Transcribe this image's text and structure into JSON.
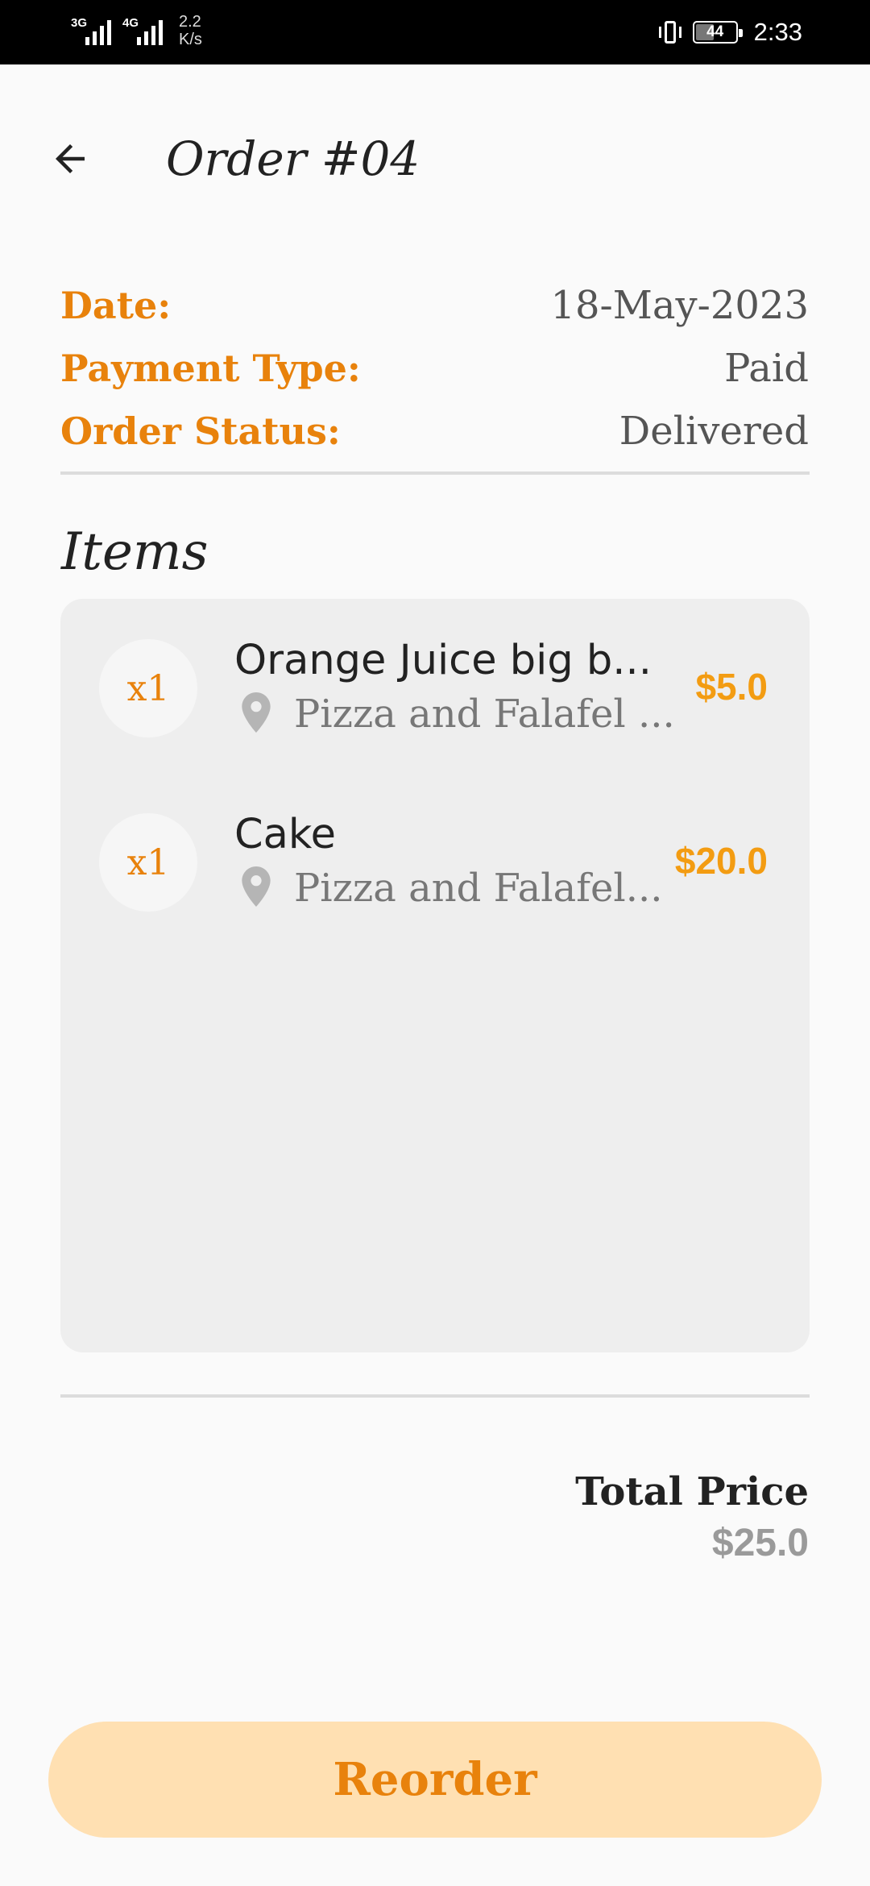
{
  "status_bar": {
    "network1": "3G",
    "network2": "4G",
    "net_speed_value": "2.2",
    "net_speed_unit": "K/s",
    "battery": "44",
    "time": "2:33"
  },
  "header": {
    "back_icon": "arrow-left-icon",
    "title": "Order #04"
  },
  "order_info": {
    "date_label": "Date:",
    "date_value": "18-May-2023",
    "payment_label": "Payment Type:",
    "payment_value": "Paid",
    "status_label": "Order Status:",
    "status_value": "Delivered"
  },
  "items_section": {
    "heading": "Items",
    "items": [
      {
        "qty": "x1",
        "name": "Orange Juice big b...",
        "store": "Pizza and Falafel ...",
        "price": "$5.0"
      },
      {
        "qty": "x1",
        "name": "Cake",
        "store": "Pizza and Falafel...",
        "price": "$20.0"
      }
    ]
  },
  "total": {
    "label": "Total Price",
    "value": "$25.0"
  },
  "actions": {
    "reorder_label": "Reorder"
  },
  "colors": {
    "accent": "#e8820c",
    "price": "#f39c12",
    "button_bg": "#ffe0b2",
    "card_bg": "#eeeeee"
  }
}
